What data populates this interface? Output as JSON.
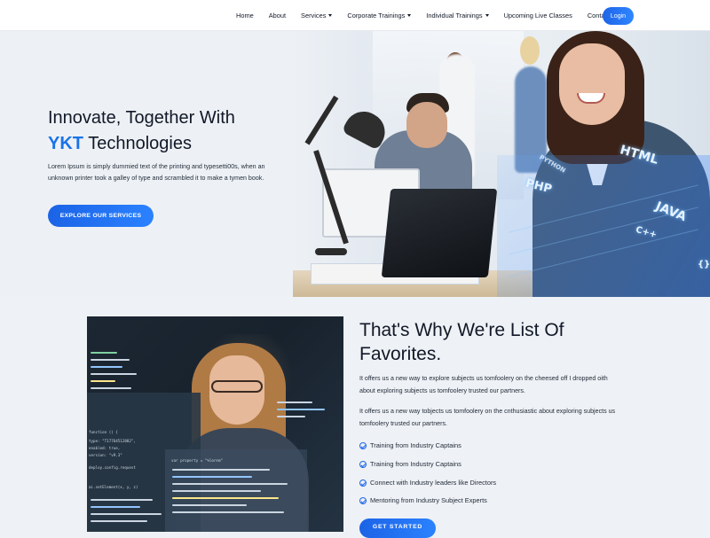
{
  "nav": {
    "items": [
      {
        "label": "Home",
        "dropdown": false
      },
      {
        "label": "About",
        "dropdown": false
      },
      {
        "label": "Services",
        "dropdown": true
      },
      {
        "label": "Corporate Trainings",
        "dropdown": true
      },
      {
        "label": "Individual Trainings",
        "dropdown": true
      },
      {
        "label": "Upcoming Live Classes",
        "dropdown": false
      },
      {
        "label": "Contact",
        "dropdown": false
      }
    ],
    "login_label": "Login"
  },
  "hero": {
    "title_line1": "Innovate, Together With",
    "title_accent": "YKT",
    "title_rest": " Technologies",
    "description": "Lorem Ipsum is simply dummied text of the printing and typesetti00s, when an unknown printer took a galley of type and scrambled it to make a tymen book.",
    "cta_label": "EXPLORE OUR SERVICES",
    "holo_words": [
      "HTML",
      "PHP",
      "PYTHON",
      "JAVA",
      "C++",
      "{}"
    ]
  },
  "section2": {
    "title": "That's Why We're List Of Favorites.",
    "paragraph1": "It offers us a new way to explore subjects us tomfoolery on the cheesed off I dropped oith about exploring subjects us tomfoolery trusted our partners.",
    "paragraph2": "It offers us a new way tobjects us tomfoolery on the cnthusiastic about exploring subjects us tomfoolery trusted our partners.",
    "features": [
      "Training from Industry Captains",
      "Training from Industry Captains",
      "Connect with Industry leaders like Directors",
      "Mentoring from Industry Subject Experts"
    ],
    "cta_label": "GET STARTED",
    "code_snippets": [
      "function () {",
      "type: \"T17764512882\",",
      "enabled: true,",
      "version: \"v9.3\"",
      "deploy.config.request",
      "ai.setElement(x, y, z)",
      "var property = \"%lorem\""
    ]
  },
  "colors": {
    "accent": "#1a73e8",
    "button": "#1d66e8",
    "background": "#eef1f5",
    "text": "#111827"
  }
}
